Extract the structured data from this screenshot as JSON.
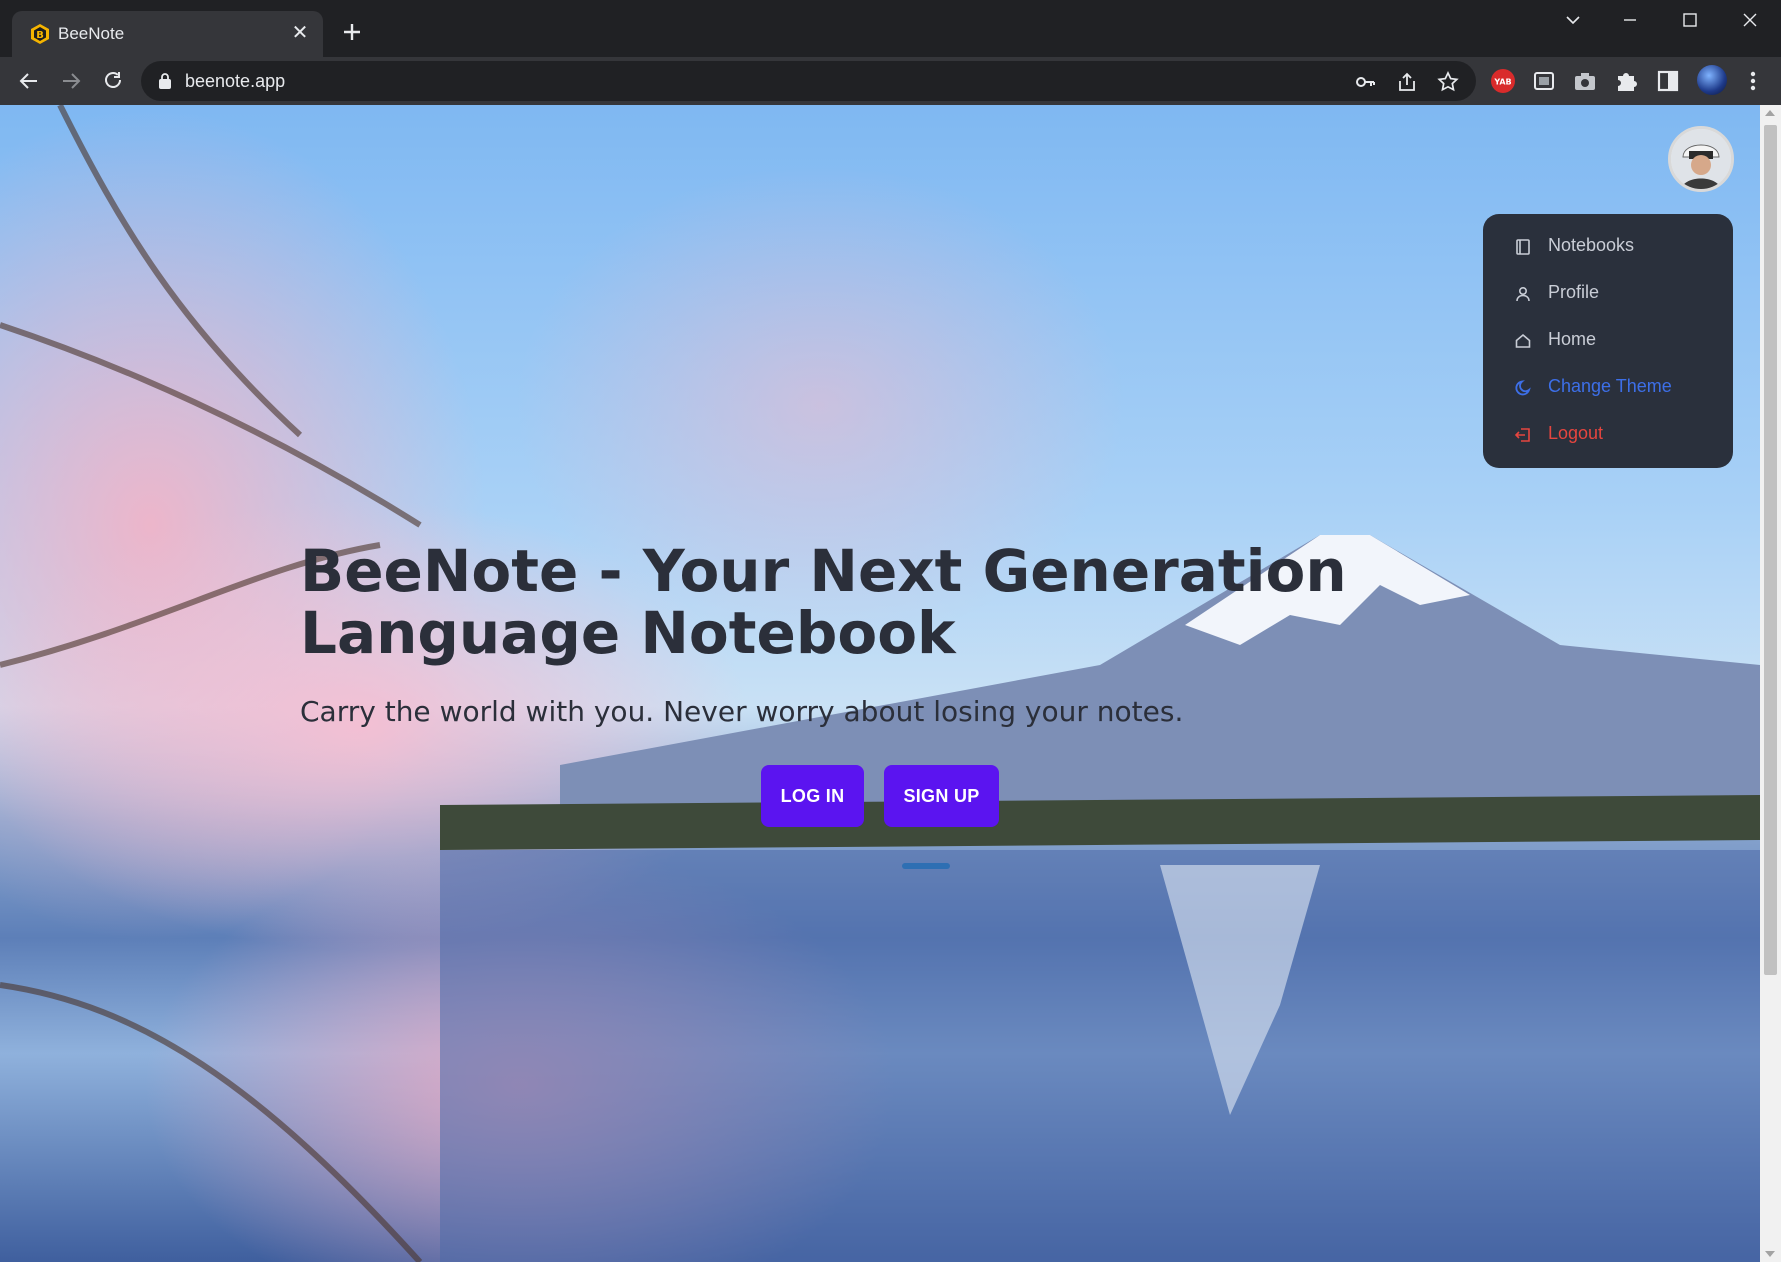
{
  "browser": {
    "tab_title": "BeeNote",
    "url": "beenote.app",
    "extensions": [
      "key-icon",
      "share-icon",
      "bookmark-star-icon",
      "yab-extension-icon",
      "screen-extension-icon",
      "camera-extension-icon",
      "puzzle-extensions-icon",
      "side-panel-icon"
    ],
    "yab_label": "YAB"
  },
  "hero": {
    "title": "BeeNote - Your Next Generation Language Notebook",
    "subtitle": "Carry the world with you. Never worry about losing your notes.",
    "login_label": "LOG IN",
    "signup_label": "SIGN UP",
    "button_color": "#5b14f0"
  },
  "menu": {
    "items": [
      {
        "label": "Notebooks",
        "icon": "notebook-icon"
      },
      {
        "label": "Profile",
        "icon": "user-icon"
      },
      {
        "label": "Home",
        "icon": "home-icon"
      },
      {
        "label": "Change Theme",
        "icon": "theme-icon",
        "color": "#3d6fe8"
      },
      {
        "label": "Logout",
        "icon": "logout-icon",
        "color": "#e5453f"
      }
    ]
  }
}
